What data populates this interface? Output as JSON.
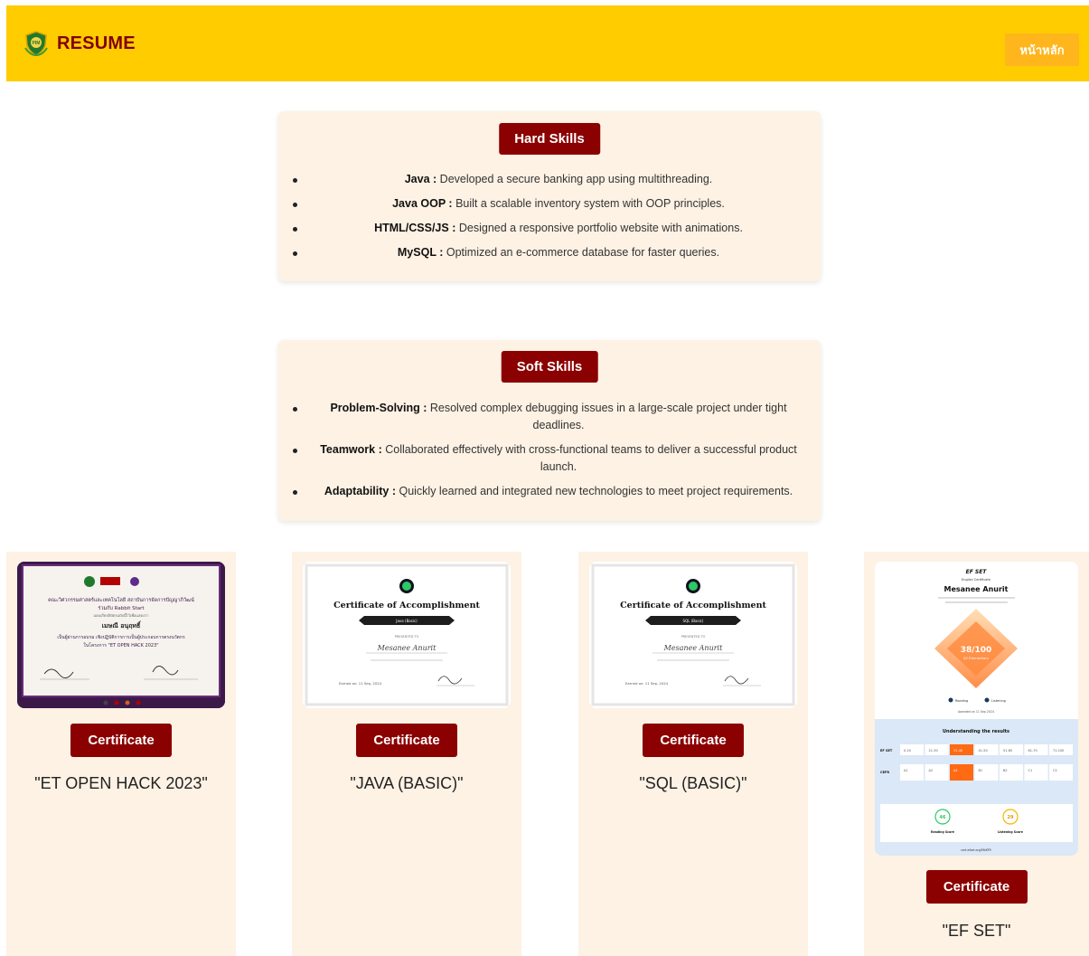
{
  "header": {
    "brand": "RESUME",
    "logo_icon": "shield-crest-logo",
    "home_button": "หน้าหลัก",
    "colors": {
      "bar": "#ffcc00",
      "brand_text": "#800000",
      "home_button": "#ffb51c"
    }
  },
  "hard_skills": {
    "title": "Hard Skills",
    "items": [
      {
        "name": "Java :",
        "desc": "Developed a secure banking app using multithreading."
      },
      {
        "name": "Java OOP :",
        "desc": "Built a scalable inventory system with OOP principles."
      },
      {
        "name": "HTML/CSS/JS :",
        "desc": "Designed a responsive portfolio website with animations."
      },
      {
        "name": "MySQL :",
        "desc": "Optimized an e-commerce database for faster queries."
      }
    ]
  },
  "soft_skills": {
    "title": "Soft Skills",
    "items": [
      {
        "name": "Problem-Solving :",
        "desc": "Resolved complex debugging issues in a large-scale project under tight deadlines."
      },
      {
        "name": "Teamwork :",
        "desc": "Collaborated effectively with cross-functional teams to deliver a successful product launch."
      },
      {
        "name": "Adaptability :",
        "desc": "Quickly learned and integrated new technologies to meet project requirements."
      }
    ]
  },
  "certificates": [
    {
      "button": "Certificate",
      "name": "\"ET OPEN HACK 2023\"",
      "thumb": {
        "line1": "คณะวิศวกรรมศาสตร์และเทคโนโลยี สถาบันการจัดการปัญญาภิวัฒน์",
        "line2": "ร่วมกับ Rabbit Start",
        "line3": "มอบเกียรติบัตรฉบับนี้ไว้เพื่อแสดงว่า",
        "recipient": "เมษณี อนุฤทธิ์",
        "line4": "เป็นผู้ผ่านการอบรม เชิงปฏิบัติการการเป็นผู้ประกอบการตรงนวัตกร",
        "line5": "ในโครงการ \"ET OPEN HACK 2023\""
      }
    },
    {
      "button": "Certificate",
      "name": "\"JAVA (BASIC)\"",
      "thumb": {
        "title": "Certificate of Accomplishment",
        "ribbon": "Java (Basic)",
        "presented": "PRESENTED TO",
        "recipient": "Mesanee Anurit",
        "date": "Earned on: 11 Sep, 2024"
      }
    },
    {
      "button": "Certificate",
      "name": "\"SQL (BASIC)\"",
      "thumb": {
        "title": "Certificate of Accomplishment",
        "ribbon": "SQL (Basic)",
        "presented": "PRESENTED TO",
        "recipient": "Mesanee Anurit",
        "date": "Earned on: 11 Sep, 2024"
      }
    },
    {
      "button": "Certificate",
      "name": "\"EF SET\"",
      "thumb": {
        "brand": "EF SET",
        "subtitle": "English Certificate",
        "recipient": "Mesanee Anurit",
        "score": "38/100",
        "level": "A2 Elementary",
        "legend_reading": "Reading",
        "legend_listening": "Listening",
        "awarded": "Awarded on 11 Sep 2024",
        "results_title": "Understanding the results",
        "efset_label": "EF SET",
        "cefr_label": "CEFR",
        "efset_ranges": [
          "0-20",
          "21-30",
          "31-40",
          "41-50",
          "51-60",
          "61-70",
          "71-100"
        ],
        "cefr_levels": [
          "A1",
          "A2",
          "A2",
          "B1",
          "B2",
          "C1",
          "C2"
        ],
        "reading_score": "46",
        "listening_score": "29",
        "reading_label": "Reading Score",
        "listening_label": "Listening Score",
        "url": "cert.efset.org/FAtKP5"
      }
    }
  ]
}
